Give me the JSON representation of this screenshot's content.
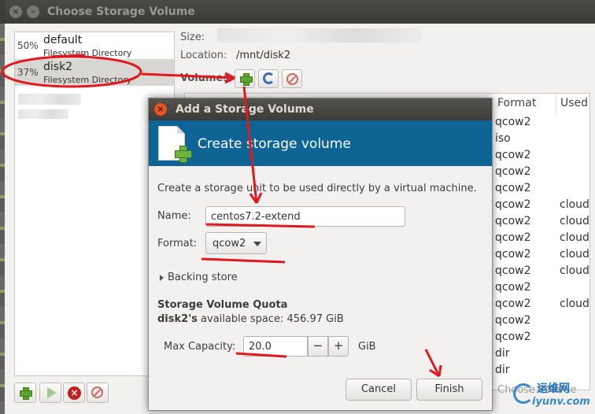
{
  "window": {
    "title": "Choose Storage Volume"
  },
  "pools": [
    {
      "percent": "50%",
      "name": "default",
      "type": "Filesystem Directory"
    },
    {
      "percent": "37%",
      "name": "disk2",
      "type": "Filesystem Directory"
    }
  ],
  "details": {
    "size_label": "Size:",
    "location_label": "Location:",
    "location_value": "/mnt/disk2",
    "volumes_label": "Volumes"
  },
  "table": {
    "columns": [
      "Format",
      "Used"
    ],
    "rows": [
      {
        "format": "qcow2",
        "used": ""
      },
      {
        "format": "iso",
        "used": ""
      },
      {
        "format": "qcow2",
        "used": ""
      },
      {
        "format": "qcow2",
        "used": ""
      },
      {
        "format": "qcow2",
        "used": ""
      },
      {
        "format": "qcow2",
        "used": "cloud"
      },
      {
        "format": "qcow2",
        "used": "cloud"
      },
      {
        "format": "qcow2",
        "used": "cloud"
      },
      {
        "format": "qcow2",
        "used": "cloud"
      },
      {
        "format": "qcow2",
        "used": "cloud"
      },
      {
        "format": "qcow2",
        "used": ""
      },
      {
        "format": "qcow2",
        "used": "cloud"
      },
      {
        "format": "qcow2",
        "used": ""
      },
      {
        "format": "qcow2",
        "used": ""
      },
      {
        "format": "dir",
        "used": ""
      },
      {
        "format": "dir",
        "used": ""
      }
    ]
  },
  "choose_button": "Choose Volume",
  "dialog": {
    "title": "Add a Storage Volume",
    "header": "Create storage volume",
    "description": "Create a storage unit to be used directly by a virtual machine.",
    "name_label": "Name:",
    "name_value": "centos7.2-extend",
    "format_label": "Format:",
    "format_value": "qcow2",
    "backing_store": "Backing store",
    "quota_title": "Storage Volume Quota",
    "avail_pool": "disk2's",
    "avail_text": " available space: 456.97 GiB",
    "max_capacity_label": "Max Capacity:",
    "max_capacity_value": "20.0",
    "unit": "GiB",
    "minus": "−",
    "plus": "+",
    "cancel": "Cancel",
    "finish": "Finish"
  },
  "watermark": {
    "name": "运维网",
    "url": "iyunv.com"
  },
  "colors": {
    "header_blue": "#0f6496",
    "annotation_red": "#e0191e",
    "selection": "#d9d7d3"
  }
}
